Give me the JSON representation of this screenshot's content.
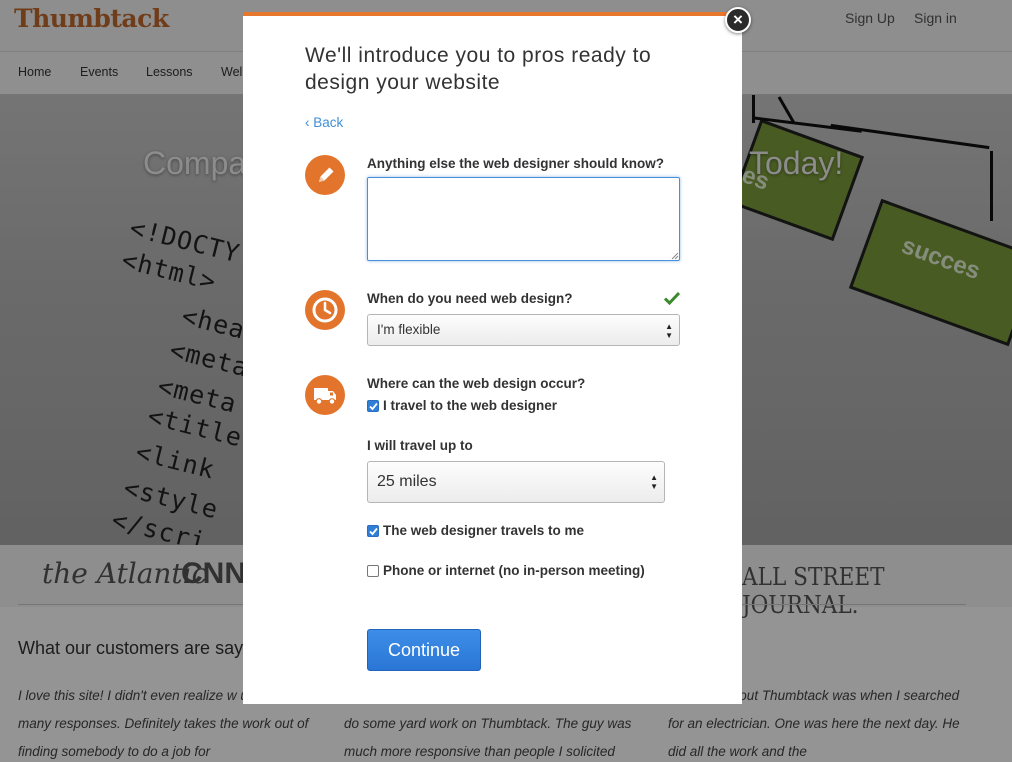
{
  "header": {
    "logo": "Thumbtack",
    "sign_up": "Sign Up",
    "sign_in": "Sign in"
  },
  "nav": {
    "items": [
      "Home",
      "Events",
      "Lessons",
      "Wel"
    ]
  },
  "hero": {
    "title_left": "Compa",
    "title_right": "Today!",
    "code_lines": [
      "<!DOCTY",
      "<html>",
      "<hea",
      "<meta",
      "<meta",
      "<title",
      "<link",
      "<style",
      "</scri"
    ],
    "flow_text_1": "es",
    "flow_text_2": "succes"
  },
  "press": {
    "logos": [
      "the Atlantic",
      "CNN",
      "ALL STREET JOURNAL."
    ]
  },
  "testimonials": {
    "title": "What our customers are sayi",
    "quotes": [
      "I love this site! I didn't even realize w until I got so many responses. Definitely takes the work out of finding somebody to do a job for",
      "do some yard work on Thumbtack. The guy was much more responsive than people I solicited",
      "y I heard about Thumbtack was when I searched for an electrician. One was here the next day. He did all the work and the"
    ]
  },
  "modal": {
    "close_glyph": "×",
    "title": "We'll introduce you to pros ready to design your website",
    "back": "‹ Back",
    "q1": {
      "icon": "pencil-icon",
      "label": "Anything else the web designer should know?",
      "value": ""
    },
    "q2": {
      "icon": "clock-icon",
      "label": "When do you need web design?",
      "selected": "I'm flexible",
      "status_icon": "checkmark-icon"
    },
    "q3": {
      "icon": "truck-icon",
      "label": "Where can the web design occur?",
      "option_travel": "I travel to the web designer",
      "option_travel_checked": true,
      "distance_label": "I will travel up to",
      "distance_selected": "25 miles",
      "option_comes": "The web designer travels to me",
      "option_comes_checked": true,
      "option_remote": "Phone or internet (no in-person meeting)",
      "option_remote_checked": false
    },
    "continue": "Continue"
  },
  "colors": {
    "accent_orange": "#e2742c",
    "button_blue": "#2a76d6",
    "link_blue": "#3f8fd6",
    "check_green": "#3c8a2e"
  }
}
